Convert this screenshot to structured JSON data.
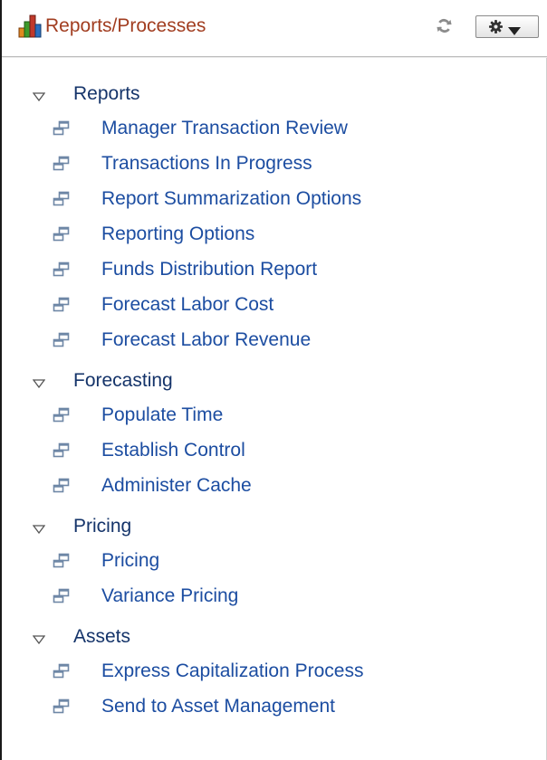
{
  "header": {
    "title": "Reports/Processes",
    "title_color": "#a13d20",
    "icons": {
      "title_icon": "bar-chart-icon",
      "refresh": "refresh-icon",
      "actions": "gear-icon",
      "actions_caret": "caret-down-icon"
    }
  },
  "sections": [
    {
      "label": "Reports",
      "expanded": true,
      "items": [
        "Manager Transaction Review",
        "Transactions In Progress",
        "Report Summarization Options",
        "Reporting Options",
        "Funds Distribution Report",
        "Forecast Labor Cost",
        "Forecast Labor Revenue"
      ]
    },
    {
      "label": "Forecasting",
      "expanded": true,
      "items": [
        "Populate Time",
        "Establish Control",
        "Administer Cache"
      ]
    },
    {
      "label": "Pricing",
      "expanded": true,
      "items": [
        "Pricing",
        "Variance Pricing"
      ]
    },
    {
      "label": "Assets",
      "expanded": true,
      "items": [
        "Express Capitalization Process",
        "Send to Asset Management"
      ]
    }
  ],
  "colors": {
    "section_label": "#15346a",
    "item_link": "#1c4da1",
    "item_icon": "#6e87a6"
  }
}
